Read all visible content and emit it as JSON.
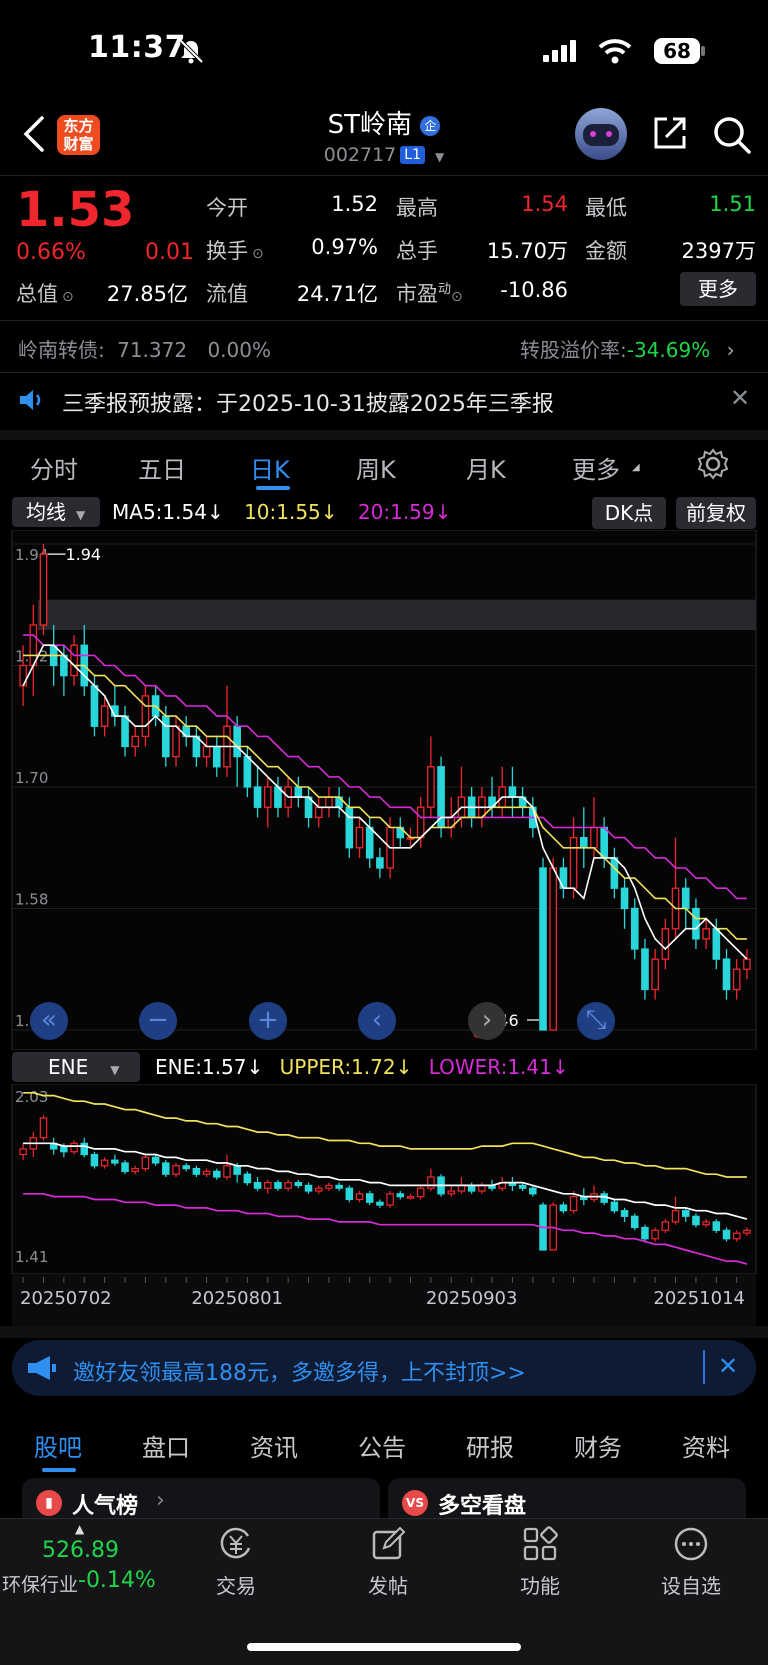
{
  "status_bar": {
    "time": "11:37",
    "battery": "68"
  },
  "header": {
    "name": "ST岭南",
    "code": "002717",
    "level": "L1",
    "logo_line1": "东方",
    "logo_line2": "财富"
  },
  "quote": {
    "price": "1.53",
    "change_pct": "0.66%",
    "change": "0.01",
    "open_label": "今开",
    "open": "1.52",
    "high_label": "最高",
    "high": "1.54",
    "low_label": "最低",
    "low": "1.51",
    "turnover_label": "换手",
    "turnover": "0.97%",
    "volume_label": "总手",
    "volume": "15.70万",
    "amount_label": "金额",
    "amount": "2397万",
    "mktcap_label": "总值",
    "mktcap": "27.85亿",
    "float_label": "流值",
    "float": "24.71亿",
    "pe_label": "市盈",
    "pe_sup": "动",
    "pe": "-10.86",
    "more_button": "更多"
  },
  "bond": {
    "label": "岭南转债:",
    "price": "71.372",
    "pct": "0.00%",
    "premium_label": "转股溢价率:",
    "premium": "-34.69%"
  },
  "notice": {
    "text": "三季报预披露：于2025-10-31披露2025年三季报"
  },
  "chart_tabs": [
    "分时",
    "五日",
    "日K",
    "周K",
    "月K",
    "更多"
  ],
  "active_tab": "日K",
  "ma_bar": {
    "selector": "均线",
    "ma5": "MA5:1.54",
    "ma10": "10:1.55",
    "ma20": "20:1.59",
    "dk": "DK点",
    "adjust": "前复权"
  },
  "ene_bar": {
    "selector": "ENE",
    "ene": "ENE:1.57",
    "upper": "UPPER:1.72",
    "lower": "LOWER:1.41"
  },
  "colors": {
    "up": "#f0262e",
    "down": "#29d6da",
    "ma5": "#ffffff",
    "ma10": "#f2e15a",
    "ma20": "#d62bd6",
    "accent": "#2f6fe0"
  },
  "chart_data": {
    "type": "candlestick",
    "main_axis": {
      "ylim": [
        1.46,
        1.94
      ],
      "ticks": [
        "1.94",
        "1.82",
        "1.70",
        "1.58",
        "1.46"
      ]
    },
    "sub_axis": {
      "ylim": [
        1.41,
        2.03
      ],
      "ticks": [
        "2.03",
        "1.41"
      ]
    },
    "x_labels": [
      "20250702",
      "20250801",
      "20250903",
      "20251014"
    ],
    "annotations": {
      "max": "1.94",
      "min": "1.46"
    },
    "candles": [
      [
        1.8,
        1.82,
        1.78,
        1.84
      ],
      [
        1.82,
        1.86,
        1.79,
        1.88
      ],
      [
        1.86,
        1.93,
        1.85,
        1.94
      ],
      [
        1.84,
        1.82,
        1.8,
        1.86
      ],
      [
        1.83,
        1.81,
        1.79,
        1.84
      ],
      [
        1.81,
        1.84,
        1.8,
        1.85
      ],
      [
        1.84,
        1.8,
        1.79,
        1.86
      ],
      [
        1.8,
        1.76,
        1.75,
        1.81
      ],
      [
        1.76,
        1.78,
        1.75,
        1.79
      ],
      [
        1.78,
        1.77,
        1.76,
        1.8
      ],
      [
        1.77,
        1.74,
        1.73,
        1.78
      ],
      [
        1.74,
        1.75,
        1.73,
        1.76
      ],
      [
        1.75,
        1.79,
        1.74,
        1.8
      ],
      [
        1.79,
        1.77,
        1.76,
        1.8
      ],
      [
        1.77,
        1.73,
        1.72,
        1.78
      ],
      [
        1.73,
        1.76,
        1.72,
        1.77
      ],
      [
        1.76,
        1.75,
        1.74,
        1.77
      ],
      [
        1.75,
        1.73,
        1.72,
        1.76
      ],
      [
        1.73,
        1.74,
        1.72,
        1.75
      ],
      [
        1.74,
        1.72,
        1.71,
        1.75
      ],
      [
        1.72,
        1.76,
        1.71,
        1.8
      ],
      [
        1.76,
        1.73,
        1.7,
        1.77
      ],
      [
        1.73,
        1.7,
        1.69,
        1.74
      ],
      [
        1.7,
        1.68,
        1.67,
        1.72
      ],
      [
        1.68,
        1.7,
        1.66,
        1.71
      ],
      [
        1.7,
        1.68,
        1.67,
        1.71
      ],
      [
        1.68,
        1.7,
        1.67,
        1.71
      ],
      [
        1.7,
        1.69,
        1.68,
        1.71
      ],
      [
        1.69,
        1.67,
        1.66,
        1.7
      ],
      [
        1.67,
        1.68,
        1.66,
        1.69
      ],
      [
        1.68,
        1.69,
        1.67,
        1.7
      ],
      [
        1.69,
        1.68,
        1.67,
        1.7
      ],
      [
        1.68,
        1.64,
        1.63,
        1.69
      ],
      [
        1.64,
        1.66,
        1.63,
        1.67
      ],
      [
        1.66,
        1.63,
        1.62,
        1.67
      ],
      [
        1.63,
        1.62,
        1.61,
        1.64
      ],
      [
        1.62,
        1.66,
        1.61,
        1.67
      ],
      [
        1.66,
        1.65,
        1.64,
        1.67
      ],
      [
        1.65,
        1.65,
        1.64,
        1.66
      ],
      [
        1.65,
        1.68,
        1.64,
        1.69
      ],
      [
        1.68,
        1.72,
        1.67,
        1.75
      ],
      [
        1.72,
        1.66,
        1.65,
        1.73
      ],
      [
        1.66,
        1.67,
        1.65,
        1.69
      ],
      [
        1.67,
        1.69,
        1.66,
        1.72
      ],
      [
        1.69,
        1.67,
        1.66,
        1.7
      ],
      [
        1.67,
        1.69,
        1.66,
        1.7
      ],
      [
        1.69,
        1.68,
        1.67,
        1.71
      ],
      [
        1.68,
        1.7,
        1.67,
        1.72
      ],
      [
        1.7,
        1.69,
        1.67,
        1.72
      ],
      [
        1.69,
        1.68,
        1.67,
        1.7
      ],
      [
        1.68,
        1.66,
        1.65,
        1.69
      ],
      [
        1.62,
        1.46,
        1.46,
        1.63
      ],
      [
        1.46,
        1.62,
        1.46,
        1.63
      ],
      [
        1.62,
        1.6,
        1.59,
        1.63
      ],
      [
        1.6,
        1.65,
        1.59,
        1.67
      ],
      [
        1.65,
        1.64,
        1.62,
        1.68
      ],
      [
        1.64,
        1.66,
        1.63,
        1.69
      ],
      [
        1.66,
        1.63,
        1.62,
        1.67
      ],
      [
        1.63,
        1.6,
        1.59,
        1.64
      ],
      [
        1.6,
        1.58,
        1.56,
        1.61
      ],
      [
        1.58,
        1.54,
        1.53,
        1.59
      ],
      [
        1.54,
        1.5,
        1.49,
        1.55
      ],
      [
        1.5,
        1.53,
        1.49,
        1.54
      ],
      [
        1.53,
        1.56,
        1.52,
        1.57
      ],
      [
        1.56,
        1.6,
        1.55,
        1.65
      ],
      [
        1.6,
        1.58,
        1.56,
        1.61
      ],
      [
        1.58,
        1.55,
        1.54,
        1.59
      ],
      [
        1.55,
        1.56,
        1.54,
        1.57
      ],
      [
        1.56,
        1.53,
        1.52,
        1.57
      ],
      [
        1.53,
        1.5,
        1.49,
        1.54
      ],
      [
        1.5,
        1.52,
        1.49,
        1.53
      ],
      [
        1.52,
        1.53,
        1.51,
        1.54
      ]
    ],
    "ma5": [
      1.8,
      1.82,
      1.84,
      1.84,
      1.83,
      1.82,
      1.81,
      1.8,
      1.79,
      1.77,
      1.77,
      1.76,
      1.76,
      1.77,
      1.76,
      1.76,
      1.75,
      1.75,
      1.74,
      1.74,
      1.74,
      1.74,
      1.73,
      1.72,
      1.71,
      1.7,
      1.69,
      1.69,
      1.69,
      1.68,
      1.68,
      1.68,
      1.67,
      1.67,
      1.66,
      1.65,
      1.64,
      1.64,
      1.64,
      1.65,
      1.66,
      1.67,
      1.67,
      1.68,
      1.68,
      1.68,
      1.68,
      1.69,
      1.69,
      1.69,
      1.68,
      1.64,
      1.62,
      1.6,
      1.6,
      1.59,
      1.63,
      1.63,
      1.63,
      1.62,
      1.6,
      1.57,
      1.55,
      1.54,
      1.55,
      1.56,
      1.56,
      1.57,
      1.56,
      1.55,
      1.54,
      1.53
    ],
    "ma10": [
      1.83,
      1.83,
      1.83,
      1.83,
      1.83,
      1.82,
      1.82,
      1.81,
      1.81,
      1.8,
      1.8,
      1.79,
      1.78,
      1.78,
      1.77,
      1.77,
      1.76,
      1.76,
      1.75,
      1.75,
      1.75,
      1.74,
      1.74,
      1.73,
      1.72,
      1.72,
      1.71,
      1.7,
      1.7,
      1.69,
      1.69,
      1.69,
      1.68,
      1.68,
      1.67,
      1.67,
      1.66,
      1.66,
      1.65,
      1.65,
      1.66,
      1.66,
      1.66,
      1.67,
      1.67,
      1.67,
      1.68,
      1.68,
      1.68,
      1.68,
      1.68,
      1.66,
      1.65,
      1.64,
      1.64,
      1.64,
      1.64,
      1.63,
      1.62,
      1.61,
      1.61,
      1.6,
      1.59,
      1.59,
      1.58,
      1.58,
      1.57,
      1.57,
      1.56,
      1.56,
      1.55,
      1.55
    ],
    "ma20": [
      1.85,
      1.85,
      1.84,
      1.84,
      1.84,
      1.83,
      1.83,
      1.83,
      1.82,
      1.82,
      1.81,
      1.81,
      1.8,
      1.8,
      1.79,
      1.79,
      1.78,
      1.78,
      1.78,
      1.77,
      1.77,
      1.76,
      1.76,
      1.75,
      1.75,
      1.74,
      1.73,
      1.73,
      1.72,
      1.72,
      1.71,
      1.71,
      1.7,
      1.7,
      1.69,
      1.69,
      1.68,
      1.68,
      1.68,
      1.67,
      1.67,
      1.67,
      1.67,
      1.67,
      1.67,
      1.67,
      1.67,
      1.67,
      1.67,
      1.67,
      1.67,
      1.67,
      1.66,
      1.66,
      1.66,
      1.66,
      1.66,
      1.66,
      1.65,
      1.65,
      1.64,
      1.64,
      1.63,
      1.63,
      1.62,
      1.62,
      1.61,
      1.61,
      1.6,
      1.6,
      1.59,
      1.59
    ],
    "ene_upper": [
      2.02,
      2.02,
      2.01,
      2.01,
      2.0,
      1.99,
      1.99,
      1.98,
      1.98,
      1.97,
      1.96,
      1.96,
      1.95,
      1.94,
      1.93,
      1.93,
      1.92,
      1.92,
      1.91,
      1.91,
      1.9,
      1.9,
      1.89,
      1.88,
      1.88,
      1.87,
      1.87,
      1.86,
      1.86,
      1.86,
      1.85,
      1.85,
      1.85,
      1.84,
      1.84,
      1.83,
      1.83,
      1.83,
      1.82,
      1.82,
      1.82,
      1.82,
      1.82,
      1.82,
      1.82,
      1.83,
      1.83,
      1.83,
      1.84,
      1.84,
      1.84,
      1.83,
      1.82,
      1.81,
      1.8,
      1.79,
      1.79,
      1.78,
      1.78,
      1.77,
      1.77,
      1.76,
      1.76,
      1.75,
      1.75,
      1.75,
      1.74,
      1.73,
      1.73,
      1.72,
      1.72,
      1.72
    ],
    "ene_mid": [
      1.84,
      1.84,
      1.84,
      1.84,
      1.83,
      1.83,
      1.83,
      1.82,
      1.82,
      1.82,
      1.81,
      1.81,
      1.8,
      1.8,
      1.79,
      1.79,
      1.78,
      1.78,
      1.78,
      1.77,
      1.77,
      1.76,
      1.76,
      1.75,
      1.75,
      1.74,
      1.74,
      1.73,
      1.73,
      1.72,
      1.72,
      1.71,
      1.71,
      1.71,
      1.7,
      1.7,
      1.69,
      1.69,
      1.69,
      1.69,
      1.69,
      1.69,
      1.69,
      1.69,
      1.69,
      1.69,
      1.69,
      1.7,
      1.7,
      1.7,
      1.69,
      1.68,
      1.67,
      1.66,
      1.66,
      1.65,
      1.65,
      1.65,
      1.64,
      1.64,
      1.63,
      1.63,
      1.62,
      1.62,
      1.61,
      1.61,
      1.6,
      1.6,
      1.59,
      1.59,
      1.58,
      1.57
    ],
    "ene_lower": [
      1.66,
      1.66,
      1.66,
      1.65,
      1.65,
      1.65,
      1.65,
      1.64,
      1.64,
      1.64,
      1.63,
      1.63,
      1.63,
      1.62,
      1.62,
      1.62,
      1.61,
      1.61,
      1.61,
      1.6,
      1.6,
      1.6,
      1.59,
      1.59,
      1.59,
      1.58,
      1.58,
      1.58,
      1.57,
      1.57,
      1.57,
      1.56,
      1.56,
      1.56,
      1.56,
      1.55,
      1.55,
      1.55,
      1.55,
      1.55,
      1.55,
      1.55,
      1.55,
      1.55,
      1.55,
      1.55,
      1.55,
      1.55,
      1.55,
      1.55,
      1.55,
      1.54,
      1.54,
      1.53,
      1.53,
      1.52,
      1.52,
      1.51,
      1.51,
      1.5,
      1.5,
      1.49,
      1.48,
      1.48,
      1.47,
      1.46,
      1.45,
      1.44,
      1.43,
      1.42,
      1.42,
      1.41
    ]
  },
  "ad_banner": {
    "text": "邀好友领最高188元，多邀多得，上不封顶>>"
  },
  "community_tabs": [
    "股吧",
    "盘口",
    "资讯",
    "公告",
    "研报",
    "财务",
    "资料"
  ],
  "active_community_tab": "股吧",
  "cards": {
    "left": "人气榜",
    "right": "多空看盘"
  },
  "bottom_nav": {
    "index_value": "526.89",
    "index_name": "环保行业",
    "index_pct": "-0.14%",
    "items": [
      "交易",
      "发帖",
      "功能",
      "设自选"
    ]
  }
}
